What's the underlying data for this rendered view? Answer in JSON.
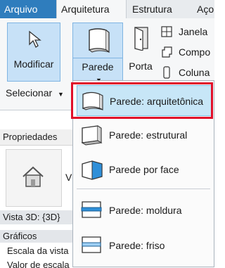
{
  "tabs": [
    {
      "label": "Arquivo"
    },
    {
      "label": "Arquitetura"
    },
    {
      "label": "Estrutura"
    },
    {
      "label": "Aço"
    }
  ],
  "ribbon": {
    "modify_label": "Modificar",
    "wall_label": "Parede",
    "door_label": "Porta",
    "window_label": "Janela",
    "component_label": "Compo",
    "column_label": "Coluna",
    "select_label": "Selecionar"
  },
  "properties": {
    "header": "Propriedades",
    "type_initial": "V",
    "view_label": "Vista 3D: {3D}",
    "graphics_label": "Gráficos",
    "scale_label": "Escala da vista",
    "cut_label": "Valor de escala"
  },
  "dropdown": {
    "items": [
      {
        "label": "Parede: arquitetônica"
      },
      {
        "label": "Parede: estrutural"
      },
      {
        "label": "Parede por face"
      },
      {
        "label": "Parede: moldura"
      },
      {
        "label": "Parede: friso"
      }
    ]
  },
  "colors": {
    "file_tab": "#2f7dbd",
    "ribbon_button_active": "#c7e1f7",
    "menu_active": "#c7e6f7",
    "highlight_border": "#e0102a"
  }
}
